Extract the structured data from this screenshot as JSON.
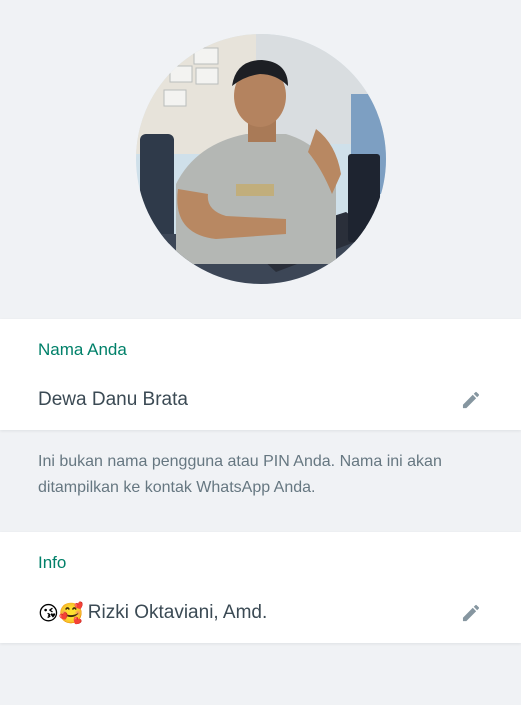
{
  "profile": {
    "photo_icon": "profile-photo"
  },
  "name_section": {
    "label": "Nama Anda",
    "value": "Dewa Danu Brata",
    "edit_icon": "pencil-icon"
  },
  "hint": {
    "text": "Ini bukan nama pengguna atau PIN Anda. Nama ini akan ditampilkan ke kontak WhatsApp Anda."
  },
  "info_section": {
    "label": "Info",
    "emoji": "😘🥰",
    "value": "Rizki Oktaviani, Amd.",
    "edit_icon": "pencil-icon"
  },
  "colors": {
    "accent": "#008069",
    "background": "#f0f2f5",
    "text": "#3b4a54",
    "muted": "#667781"
  }
}
